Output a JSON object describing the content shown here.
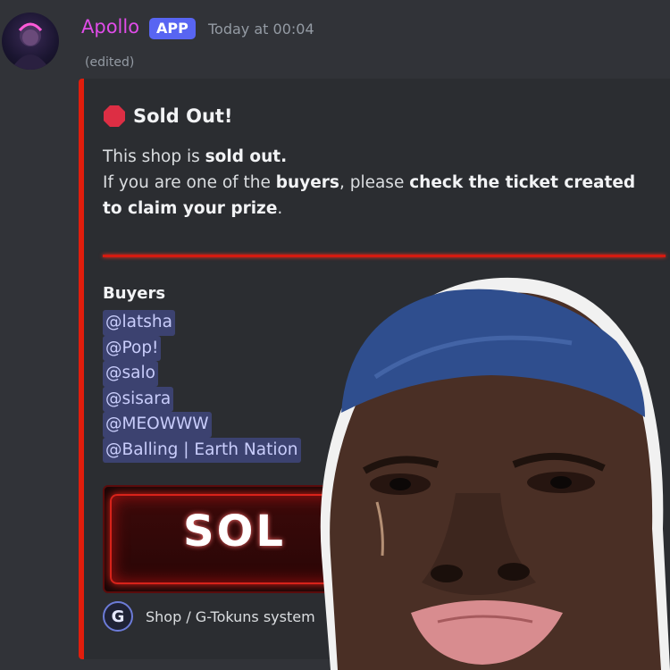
{
  "message": {
    "username": "Apollo",
    "badge": "APP",
    "timestamp": "Today at 00:04",
    "edited": "(edited)"
  },
  "embed": {
    "title": "Sold Out!",
    "title_icon": "stop-sign-icon",
    "desc_line1_prefix": "This shop is ",
    "desc_line1_bold": "sold out.",
    "desc_line2_prefix": "If you are one of the ",
    "desc_line2_bold1": "buyers",
    "desc_line2_mid": ", please ",
    "desc_line2_bold2": "check the ticket created to claim your prize",
    "desc_line2_suffix": ".",
    "buyers_title": "Buyers",
    "buyers": [
      "@latsha",
      "@Pop!",
      "@salo",
      "@sisara",
      "@MEOWWW",
      "@Balling | Earth Nation"
    ],
    "banner_text": "SOL",
    "footer_text": "Shop / G-Tokuns system",
    "footer_icon_glyph": "G",
    "accent_color": "#e11d0c"
  }
}
